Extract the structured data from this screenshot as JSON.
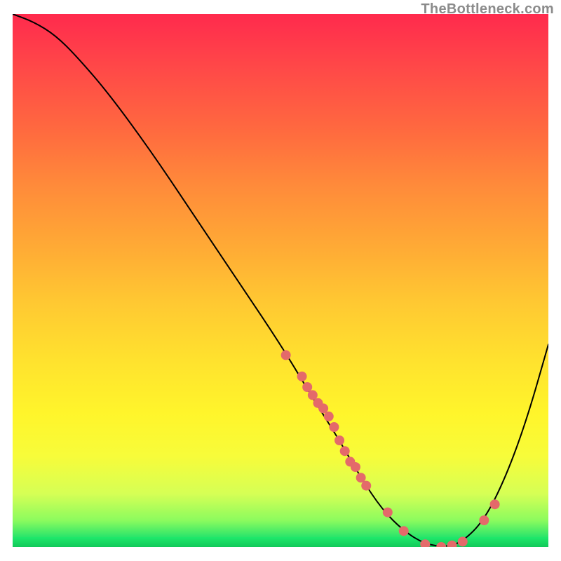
{
  "attribution": "TheBottleneck.com",
  "chart_data": {
    "type": "line",
    "title": "",
    "xlabel": "",
    "ylabel": "",
    "xlim": [
      0,
      100
    ],
    "ylim": [
      0,
      100
    ],
    "grid": false,
    "legend": false,
    "series": [
      {
        "name": "curve",
        "x": [
          0,
          4,
          8,
          12,
          18,
          26,
          34,
          42,
          50,
          56,
          61,
          65,
          69,
          73,
          77,
          81,
          84,
          88,
          92,
          96,
          100
        ],
        "values": [
          100,
          98.5,
          96,
          92,
          85,
          74,
          62,
          50,
          38,
          28,
          20,
          13,
          7,
          3,
          0.5,
          0,
          1,
          5,
          13,
          24,
          38
        ]
      }
    ],
    "markers": {
      "name": "highlighted-points",
      "x": [
        51,
        54,
        55,
        56,
        57,
        58,
        59,
        60,
        61,
        62,
        63,
        64,
        65,
        66,
        70,
        73,
        77,
        80,
        82,
        84,
        88,
        90
      ],
      "values": [
        36,
        32,
        30,
        28.5,
        27,
        26,
        24.5,
        22.5,
        20,
        18,
        16,
        15,
        13,
        11.5,
        6.5,
        3,
        0.5,
        0,
        0.3,
        1,
        5,
        8
      ],
      "color": "#e46a6a",
      "radius_px": 7
    },
    "background_gradient": {
      "top": "#ff2a4d",
      "middle": "#ffe22e",
      "bottom": "#17d463"
    }
  }
}
